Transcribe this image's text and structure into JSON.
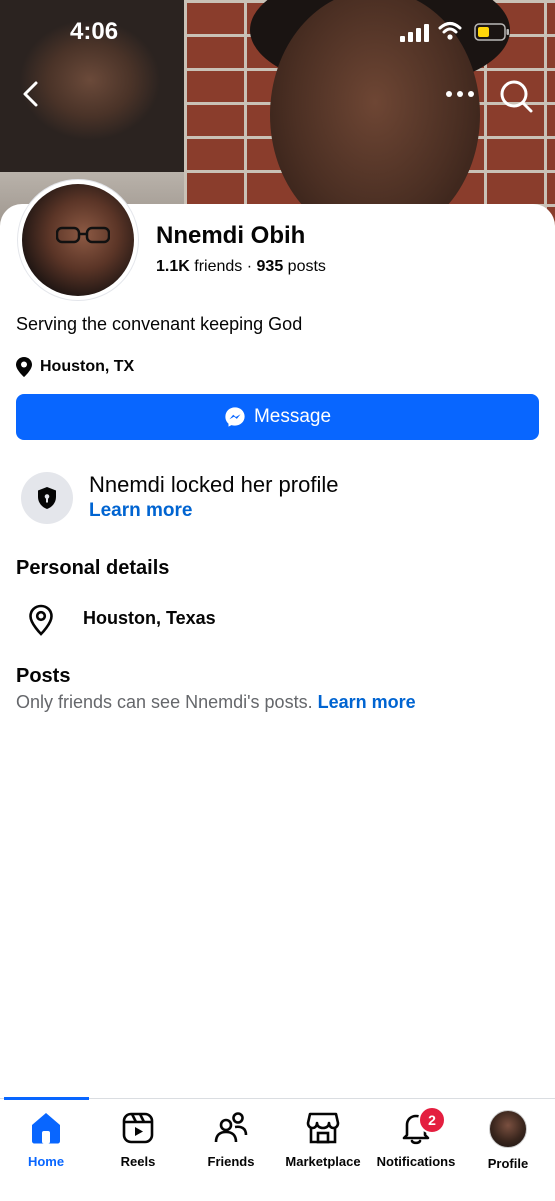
{
  "status_bar": {
    "time": "4:06"
  },
  "profile": {
    "name": "Nnemdi Obih",
    "friends_count": "1.1K",
    "friends_label": "friends",
    "separator": "·",
    "posts_count": "935",
    "posts_label": "posts",
    "bio": "Serving the convenant keeping God",
    "location_short": "Houston, TX"
  },
  "actions": {
    "message_label": "Message"
  },
  "locked": {
    "title": "Nnemdi locked her profile",
    "learn_more": "Learn more"
  },
  "personal_details": {
    "heading": "Personal details",
    "location": "Houston, Texas"
  },
  "posts": {
    "heading": "Posts",
    "note": "Only friends can see Nnemdi's posts.",
    "learn_more": "Learn more"
  },
  "tabbar": {
    "items": [
      {
        "label": "Home",
        "icon": "home-icon",
        "active": true
      },
      {
        "label": "Reels",
        "icon": "reels-icon"
      },
      {
        "label": "Friends",
        "icon": "friends-icon"
      },
      {
        "label": "Marketplace",
        "icon": "marketplace-icon"
      },
      {
        "label": "Notifications",
        "icon": "bell-icon",
        "badge": "2"
      },
      {
        "label": "Profile",
        "icon": "profile-avatar"
      }
    ]
  },
  "colors": {
    "accent": "#0866ff",
    "link": "#0064d1",
    "badge": "#e41e3f",
    "secondary_text": "#65676b"
  }
}
